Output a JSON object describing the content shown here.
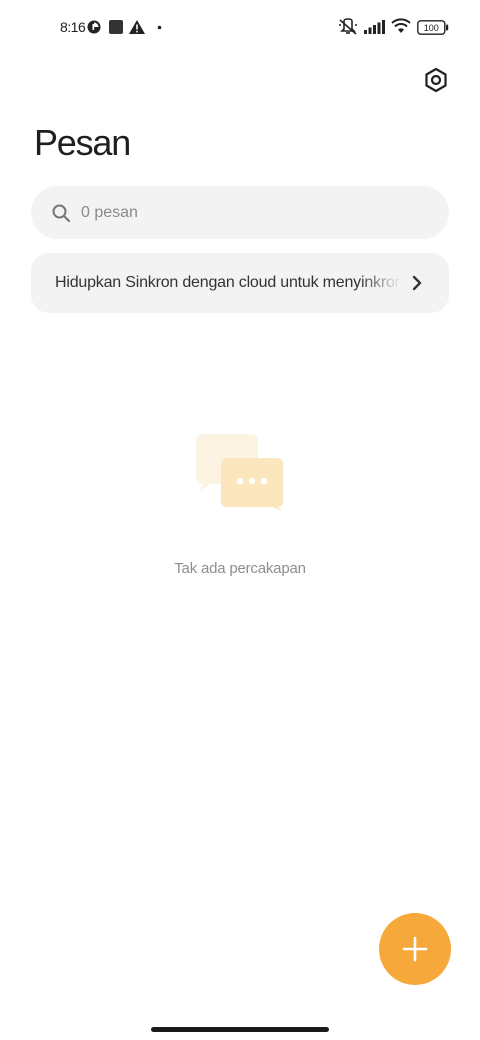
{
  "status_bar": {
    "time": "8:16",
    "icons": [
      "data-saver-icon",
      "square-notification-icon",
      "warning-icon",
      "dot-icon",
      "vibrate-off-icon",
      "signal-icon",
      "wifi-icon",
      "battery-icon"
    ],
    "battery": "100"
  },
  "header": {
    "title": "Pesan",
    "settings_icon": "settings-hexagon-icon"
  },
  "search": {
    "placeholder": "0 pesan",
    "value": ""
  },
  "sync_banner": {
    "text": "Hidupkan Sinkron dengan cloud untuk menyinkronkan pesan"
  },
  "empty_state": {
    "icon": "chat-bubbles-icon",
    "text": "Tak ada percakapan"
  },
  "fab": {
    "icon": "plus-icon"
  },
  "colors": {
    "accent": "#f7a83b",
    "card_bg": "#f3f3f3",
    "illustration_light": "#fdf1dc",
    "illustration_mid": "#fbe3b3"
  }
}
